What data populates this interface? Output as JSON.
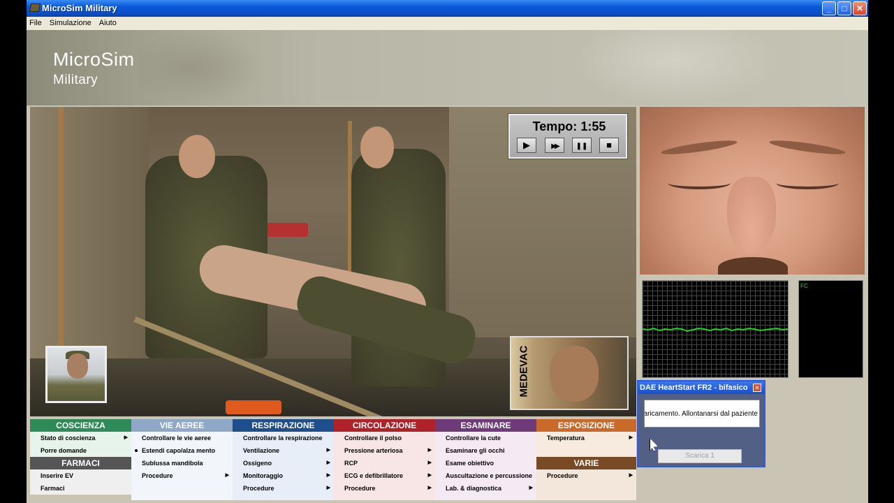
{
  "window": {
    "title": "MicroSim Military"
  },
  "window_controls": {
    "minimize": "_",
    "maximize": "□",
    "close": "✕"
  },
  "menu": [
    "File",
    "Simulazione",
    "Aiuto"
  ],
  "banner": {
    "line1": "MicroSim",
    "line2": "Military"
  },
  "timer": {
    "label": "Tempo:",
    "value": "1:55",
    "buttons": [
      "play-icon",
      "fast-forward-icon",
      "pause-icon",
      "stop-icon"
    ],
    "glyphs": [
      "▶",
      "▶▶",
      "❚❚",
      "■"
    ]
  },
  "medevac": {
    "label": "MEDEVAC"
  },
  "monitor": {
    "fc_label": "FC"
  },
  "dae": {
    "title": "DAE HeartStart FR2 - bifasico",
    "close": "✕",
    "message": "Caricamento. Allontanarsi dal paziente",
    "shock_button": "Scarica 1"
  },
  "panels": {
    "coscienza": {
      "title": "COSCIENZA",
      "color": "#2e8b57",
      "bg": "#e7f4ec",
      "items": [
        "Stato di coscienza",
        "Porre domande"
      ]
    },
    "farmaci": {
      "title": "FARMACI",
      "color": "#555555",
      "items": [
        "Inserire EV",
        "Farmaci"
      ]
    },
    "vie_aeree": {
      "title": "VIE AEREE",
      "color": "#8fa8c8",
      "bg": "#f2f5fa",
      "items": [
        "Controllare le vie aeree",
        "Estendi capo/alza mento",
        "Sublussa mandibola",
        "Procedure"
      ]
    },
    "respirazione": {
      "title": "RESPIRAZIONE",
      "color": "#1f4e8c",
      "bg": "#e8eef8",
      "items": [
        "Controllare la respirazione",
        "Ventilazione",
        "Ossigeno",
        "Monitoraggio",
        "Procedure"
      ]
    },
    "circolazione": {
      "title": "CIRCOLAZIONE",
      "color": "#b0222a",
      "bg": "#f8e6e6",
      "items": [
        "Controllare il polso",
        "Pressione arteriosa",
        "RCP",
        "ECG e defibrillatore",
        "Procedure"
      ]
    },
    "esaminare": {
      "title": "ESAMINARE",
      "color": "#6f3a78",
      "bg": "#f5e9f4",
      "items": [
        "Controllare la cute",
        "Esaminare gli occhi",
        "Esame obiettivo",
        "Auscultazione e percussione",
        "Lab. & diagnostica"
      ]
    },
    "esposizione": {
      "title": "ESPOSIZIONE",
      "color": "#c9692a",
      "bg": "#f7ebe0",
      "items": [
        "Temperatura"
      ]
    },
    "varie": {
      "title": "VARIE",
      "color": "#7a4a24",
      "items": [
        "Procedure"
      ]
    }
  }
}
